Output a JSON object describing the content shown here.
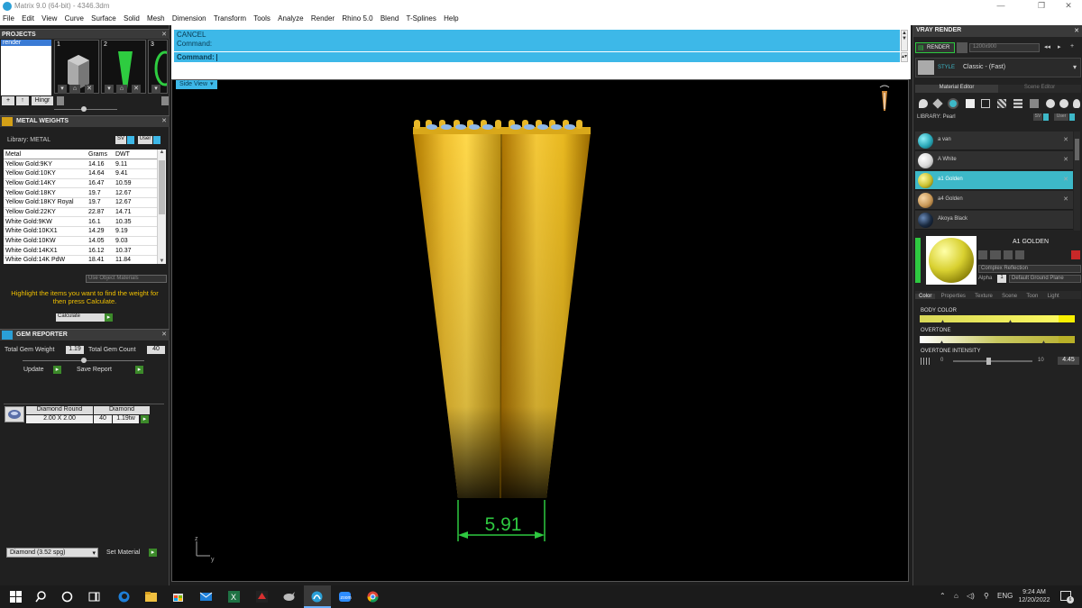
{
  "window": {
    "title": "Matrix 9.0 (64-bit) - 4346.3dm",
    "controls": [
      "—",
      "❐",
      "✕"
    ]
  },
  "menu": [
    "File",
    "Edit",
    "View",
    "Curve",
    "Surface",
    "Solid",
    "Mesh",
    "Dimension",
    "Transform",
    "Tools",
    "Analyze",
    "Render",
    "Rhino 5.0",
    "Blend",
    "T-Splines",
    "Help"
  ],
  "projects": {
    "header": "PROJECTS",
    "items": [
      "render"
    ],
    "thumb_numbers": [
      "1",
      "2",
      "3"
    ],
    "hinge_label": "Hingr"
  },
  "metal_weights": {
    "header": "METAL WEIGHTS",
    "library_label": "Library: METAL",
    "sv_label": "SV",
    "user_label": "User",
    "columns": [
      "Metal",
      "Grams",
      "DWT"
    ],
    "rows": [
      [
        "Yellow Gold:9KY",
        "14.16",
        "9.11"
      ],
      [
        "Yellow Gold:10KY",
        "14.64",
        "9.41"
      ],
      [
        "Yellow Gold:14KY",
        "16.47",
        "10.59"
      ],
      [
        "Yellow Gold:18KY",
        "19.7",
        "12.67"
      ],
      [
        "Yellow Gold:18KY Royal",
        "19.7",
        "12.67"
      ],
      [
        "Yellow Gold:22KY",
        "22.87",
        "14.71"
      ],
      [
        "White Gold:9KW",
        "16.1",
        "10.35"
      ],
      [
        "White Gold:10KX1",
        "14.29",
        "9.19"
      ],
      [
        "White Gold:10KW",
        "14.05",
        "9.03"
      ],
      [
        "White Gold:14KX1",
        "16.12",
        "10.37"
      ],
      [
        "White Gold:14K PdW",
        "18.41",
        "11.84"
      ]
    ],
    "use_object_materials": "Use Object Materials",
    "hint": "Highlight the items you want to find the weight for then press Calculate.",
    "calculate": "Calculate"
  },
  "gem_reporter": {
    "header": "GEM REPORTER",
    "total_weight_label": "Total Gem Weight",
    "total_weight": "1.19",
    "total_count_label": "Total Gem Count",
    "total_count": "40",
    "update": "Update",
    "save_report": "Save Report",
    "gem_shape": "Diamond Round",
    "gem_material": "Diamond",
    "gem_size": "2.00 X 2.00",
    "gem_count": "40",
    "gem_weight": "1.19tw",
    "material_select": "Diamond    (3.52 spg)",
    "set_material": "Set Material"
  },
  "command": {
    "history": [
      "CANCEL",
      "Command:"
    ],
    "prompt": "Command:"
  },
  "viewport": {
    "view_name": "Side View",
    "dimension": "5.91",
    "axis_z": "z",
    "axis_y": "y"
  },
  "vray": {
    "header": "VRAY RENDER",
    "render_btn": "RENDER",
    "resolution": "1200x900",
    "style_label": "STYLE",
    "style_value": "Classic - (Fast)",
    "tabs": [
      "Material Editor",
      "Scene Editor"
    ],
    "library_label": "LIBRARY: Pearl",
    "sv_label": "SV",
    "user_label": "User",
    "materials": [
      {
        "name": "a van",
        "color": "#2aa8b8"
      },
      {
        "name": "A White",
        "color": "#d8d8d8"
      },
      {
        "name": "a1 Golden",
        "color": "#c8c030"
      },
      {
        "name": "a4 Golden",
        "color": "#c89858"
      },
      {
        "name": "Akoya Black",
        "color": "#1a2a40"
      }
    ],
    "selected_material": "A1 GOLDEN",
    "reflection": "Complex Reflection",
    "alpha_label": "Alpha",
    "alpha_value": "1",
    "ground_plane": "Default Ground Plane",
    "prop_tabs": [
      "Color",
      "Properties",
      "Texture",
      "Scene",
      "Toon",
      "Light"
    ],
    "body_color_label": "BODY COLOR",
    "overtone_label": "OVERTONE",
    "overtone_intensity_label": "OVERTONE INTENSITY",
    "intensity_min": "0",
    "intensity_max": "10",
    "intensity_value": "4.45",
    "intensity_fraction": 0.445
  },
  "taskbar": {
    "lang": "ENG",
    "time": "9:24 AM",
    "date": "12/20/2022",
    "notif_count": "6"
  }
}
